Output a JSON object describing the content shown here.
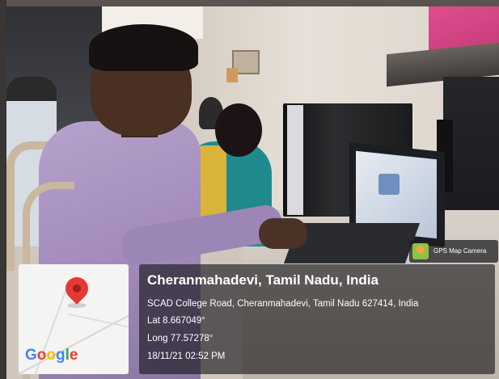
{
  "overlay": {
    "location_title": "Cheranmahadevi, Tamil Nadu, India",
    "address": "SCAD College Road, Cheranmahadevi, Tamil Nadu 627414, India",
    "latitude": "Lat 8.667049°",
    "longitude": "Long 77.57278°",
    "datetime": "18/11/21 02:52 PM"
  },
  "map": {
    "brand": [
      "G",
      "o",
      "o",
      "g",
      "l",
      "e"
    ],
    "pin_color": "#e53935"
  },
  "badge": {
    "label": "GPS Map Camera",
    "icon": "gps-map-camera-icon"
  }
}
